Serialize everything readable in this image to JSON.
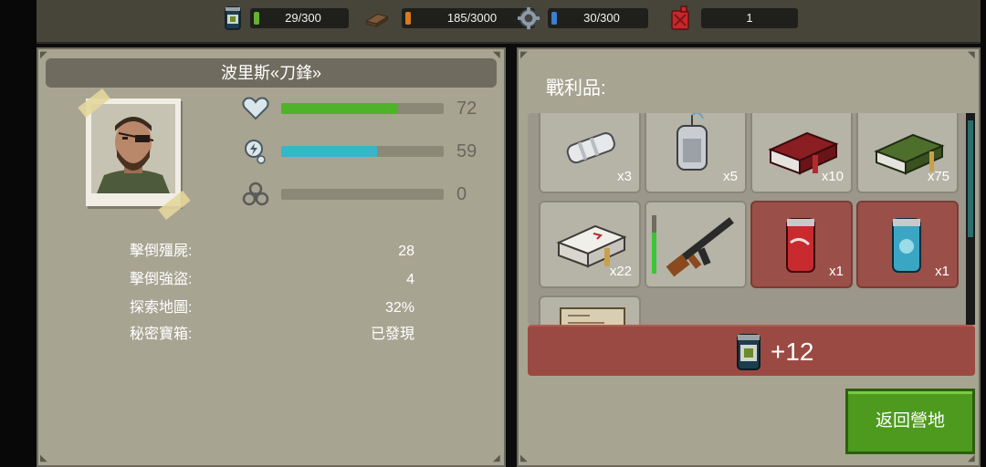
{
  "resources": [
    {
      "icon": "can-food-icon",
      "value": "29/300",
      "pip_color": "#64b32e"
    },
    {
      "icon": "wood-plank-icon",
      "value": "185/3000",
      "pip_color": "#d97a1c"
    },
    {
      "icon": "gear-parts-icon",
      "value": "30/300",
      "pip_color": "#3b7fd1"
    },
    {
      "icon": "fuel-canister-icon",
      "value": "1",
      "pip_color": ""
    }
  ],
  "character": {
    "name": "波里斯«刀鋒»",
    "stats": [
      {
        "icon": "heart-icon",
        "value": "72",
        "fill": 0.72,
        "color": "#4fb32a"
      },
      {
        "icon": "energy-icon",
        "value": "59",
        "fill": 0.59,
        "color": "#32b8c9"
      },
      {
        "icon": "biohazard-icon",
        "value": "0",
        "fill": 0,
        "color": "#808080"
      }
    ],
    "info": [
      {
        "label": "擊倒殭屍:",
        "value": "28"
      },
      {
        "label": "擊倒強盜:",
        "value": "4"
      },
      {
        "label": "探索地圖:",
        "value": "32%"
      },
      {
        "label": "秘密寶箱:",
        "value": "已發現"
      }
    ]
  },
  "loot": {
    "title": "戰利品:",
    "items": [
      {
        "icon": "bandage-icon",
        "count": "x3"
      },
      {
        "icon": "iv-bag-icon",
        "count": "x5"
      },
      {
        "icon": "shotgun-shells-red-icon",
        "count": "x10"
      },
      {
        "icon": "rifle-ammo-green-icon",
        "count": "x75"
      },
      {
        "icon": "pistol-ammo-box-icon",
        "count": "x22"
      },
      {
        "icon": "ak-rifle-icon",
        "count": ""
      },
      {
        "icon": "soda-can-red-icon",
        "count": "x1"
      },
      {
        "icon": "soda-can-blue-icon",
        "count": "x1"
      },
      {
        "icon": "map-scroll-icon",
        "count": ""
      }
    ],
    "weapon_durability": 0.7,
    "reward": {
      "icon": "can-food-icon",
      "text": "+12"
    }
  },
  "actions": {
    "return_label": "返回營地"
  }
}
